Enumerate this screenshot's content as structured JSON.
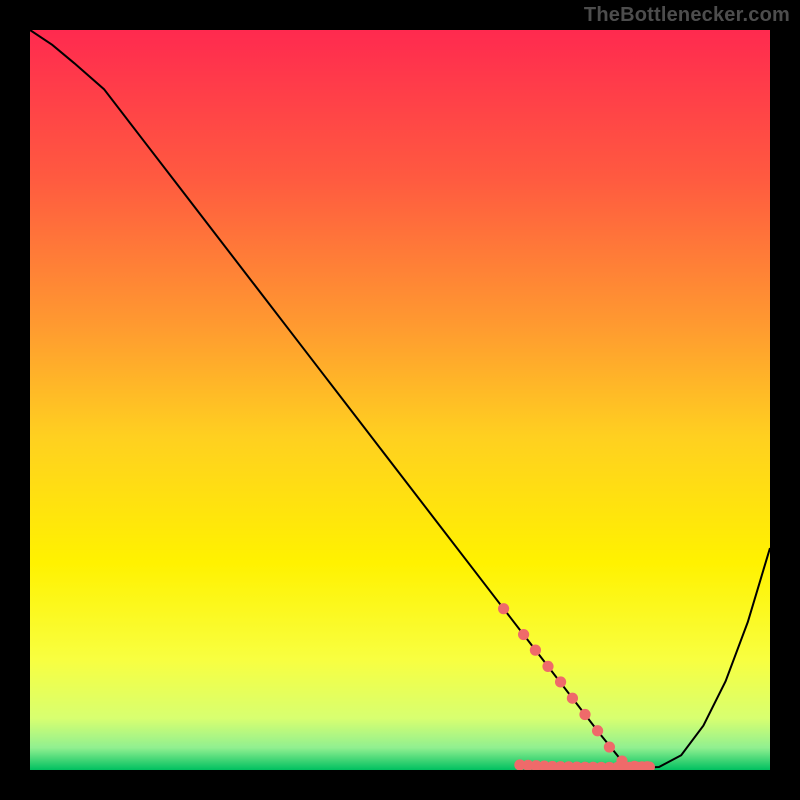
{
  "watermark": "TheBottlenecker.com",
  "chart_data": {
    "type": "line",
    "title": "",
    "xlabel": "",
    "ylabel": "",
    "xlim": [
      0,
      100
    ],
    "ylim": [
      0,
      100
    ],
    "grid": false,
    "legend": false,
    "background": "rainbow_vertical_gradient",
    "gradient_stops": [
      {
        "offset": 0.0,
        "color": "#ff2a4f"
      },
      {
        "offset": 0.2,
        "color": "#ff5a40"
      },
      {
        "offset": 0.4,
        "color": "#ff9a30"
      },
      {
        "offset": 0.55,
        "color": "#ffd020"
      },
      {
        "offset": 0.72,
        "color": "#fff200"
      },
      {
        "offset": 0.85,
        "color": "#f8ff40"
      },
      {
        "offset": 0.93,
        "color": "#d8ff70"
      },
      {
        "offset": 0.97,
        "color": "#90f090"
      },
      {
        "offset": 1.0,
        "color": "#00c060"
      }
    ],
    "series": [
      {
        "name": "bottleneck_curve",
        "stroke": "#000000",
        "stroke_width": 2,
        "x": [
          0,
          3,
          6,
          10,
          15,
          20,
          25,
          30,
          35,
          40,
          45,
          50,
          55,
          60,
          64,
          65,
          67,
          70,
          73,
          77,
          80,
          82,
          83,
          85,
          88,
          91,
          94,
          97,
          100
        ],
        "y": [
          100,
          98,
          95.5,
          92,
          85.5,
          79,
          72.5,
          66,
          59.5,
          53,
          46.5,
          40,
          33.5,
          27,
          21.8,
          20.5,
          17.9,
          14,
          10.1,
          4.9,
          1.2,
          0.4,
          0.3,
          0.4,
          2,
          6,
          12,
          20,
          30
        ]
      }
    ],
    "markers": {
      "name": "highlight_points",
      "fill": "#ef6a6a",
      "radius": 5.6,
      "x": [
        64.0,
        66.7,
        68.3,
        70.0,
        71.7,
        73.3,
        75.0,
        76.7,
        78.3,
        80.0,
        81.7,
        83.0,
        83.7
      ],
      "y": [
        21.8,
        18.3,
        16.2,
        14.0,
        11.9,
        9.7,
        7.5,
        5.3,
        3.1,
        1.2,
        0.5,
        0.3,
        0.4
      ]
    },
    "bottom_markers_dense": {
      "name": "min_zone_dots",
      "fill": "#ef6a6a",
      "radius": 5.6,
      "x": [
        66.2,
        67.3,
        68.4,
        69.5,
        70.6,
        71.7,
        72.8,
        73.9,
        75.0,
        76.1,
        77.2,
        78.3,
        79.4,
        80.5,
        81.1,
        82.0,
        82.7,
        83.4
      ],
      "y": [
        0.68,
        0.62,
        0.57,
        0.52,
        0.48,
        0.45,
        0.42,
        0.4,
        0.38,
        0.37,
        0.36,
        0.36,
        0.36,
        0.37,
        0.38,
        0.4,
        0.42,
        0.45
      ]
    }
  }
}
